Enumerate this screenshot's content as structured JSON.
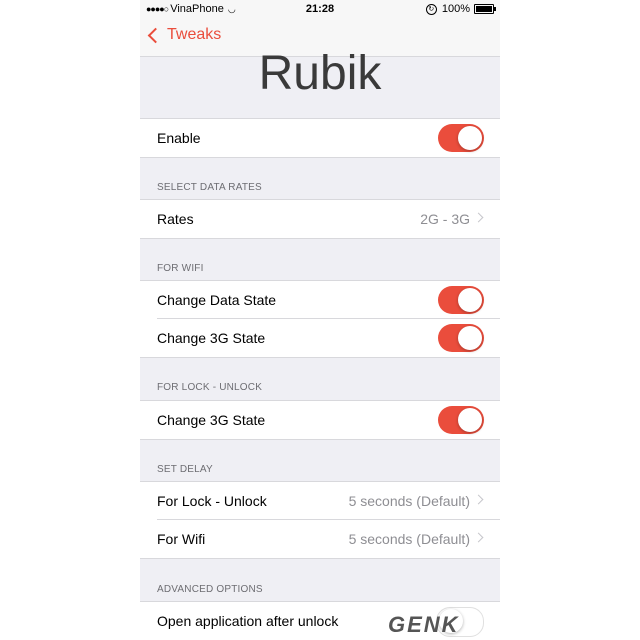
{
  "status_bar": {
    "signal": "●●●●○",
    "carrier": "VinaPhone",
    "time": "21:28",
    "battery_percent": "100%"
  },
  "nav": {
    "back_label": "Tweaks"
  },
  "app_title": "Rubik",
  "accent_color": "#ea4d3c",
  "sections": {
    "enable": {
      "label": "Enable",
      "on": true
    },
    "data_rates": {
      "header": "SELECT DATA RATES",
      "rates_label": "Rates",
      "rates_value": "2G - 3G"
    },
    "wifi": {
      "header": "FOR WIFI",
      "change_data_state": {
        "label": "Change Data State",
        "on": true
      },
      "change_3g_state": {
        "label": "Change 3G State",
        "on": true
      }
    },
    "lock_unlock": {
      "header": "FOR LOCK - UNLOCK",
      "change_3g_state": {
        "label": "Change 3G State",
        "on": true
      }
    },
    "delay": {
      "header": "SET DELAY",
      "lock_unlock_label": "For Lock - Unlock",
      "lock_unlock_value": "5 seconds (Default)",
      "wifi_label": "For Wifi",
      "wifi_value": "5 seconds (Default)"
    },
    "advanced": {
      "header": "ADVANCED OPTIONS",
      "open_app": {
        "label": "Open application after unlock",
        "on": false
      }
    }
  },
  "watermark": "GENK"
}
